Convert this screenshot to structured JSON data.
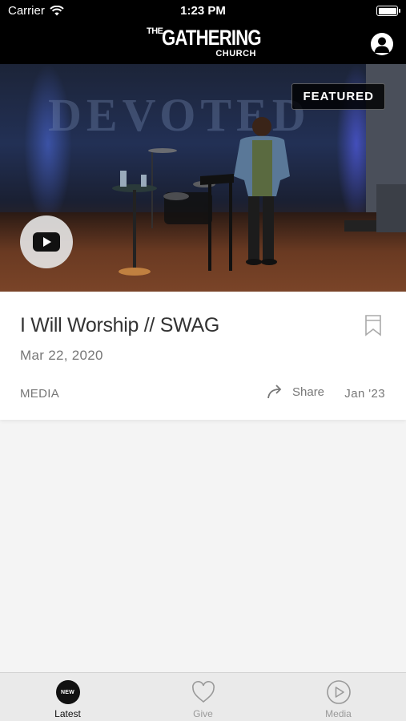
{
  "status_bar": {
    "carrier": "Carrier",
    "time": "1:23 PM"
  },
  "header": {
    "logo": {
      "the": "THE",
      "gathering": "GATHERING",
      "church": "CHURCH"
    },
    "profile_icon": "person-icon"
  },
  "hero": {
    "wall_text": "DEVOTED",
    "badge": "FEATURED",
    "play_icon": "youtube-play-icon"
  },
  "card": {
    "title": "I Will Worship // SWAG",
    "date": "Mar 22, 2020",
    "category": "MEDIA",
    "share_label": "Share",
    "short_date": "Jan '23",
    "bookmark_icon": "bookmark-icon"
  },
  "tabs": [
    {
      "label": "Latest",
      "icon": "new-badge-icon",
      "badge_text": "NEW",
      "active": true
    },
    {
      "label": "Give",
      "icon": "heart-icon",
      "active": false
    },
    {
      "label": "Media",
      "icon": "play-circle-icon",
      "active": false
    }
  ],
  "colors": {
    "header_bg": "#000000",
    "card_bg": "#ffffff",
    "page_bg": "#f4f4f4",
    "tabbar_bg": "#eaeaea",
    "muted_text": "#777777"
  }
}
